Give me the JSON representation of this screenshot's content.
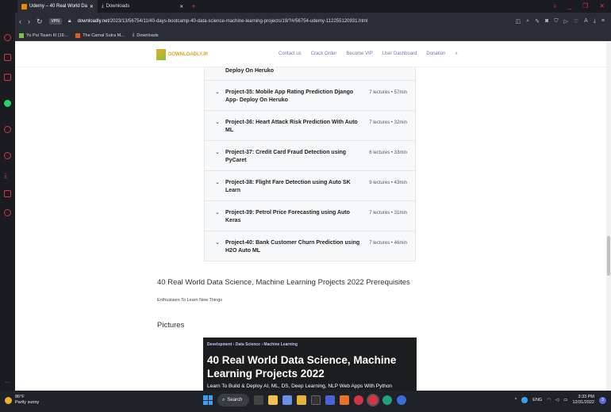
{
  "browser": {
    "tabs": [
      {
        "label": "Udemy – 40 Real World Da",
        "active": true
      },
      {
        "label": "Downloads",
        "active": false
      }
    ],
    "new_tab": "+",
    "vpn": "VPN",
    "url_domain": "downloadly.net",
    "url_path": "/2023/13/56754/11/40-days-bootcamp-40-data-science-machine-learning-projects/19/?#/56754-udemy-112255120931.html",
    "bookmarks": [
      "Yu Pui Tsuen III (19...",
      "The Carnal Sutra M...",
      "Downloads"
    ]
  },
  "site": {
    "logo_text": "DOWNLOADLY.IR",
    "menu": [
      "Contact us",
      "Crack Order",
      "Become VIP",
      "User Dashboard",
      "Donation"
    ],
    "partial_row_title": "Deploy On Heruko",
    "course_rows": [
      {
        "title": "Project-35: Mobile App Rating Prediction Django App- Deploy On Heruko",
        "meta": "7 lectures • 57min"
      },
      {
        "title": "Project-36: Heart Attack Risk Prediction With Auto ML",
        "meta": "7 lectures • 32min"
      },
      {
        "title": "Project-37: Credit Card Fraud Detection using PyCaret",
        "meta": "6 lectures • 33min"
      },
      {
        "title": "Project-38: Flight Fare Detection using Auto SK Learn",
        "meta": "9 lectures • 43min"
      },
      {
        "title": "Project-39: Petrol Price Forecasting using Auto Keras",
        "meta": "7 lectures • 31min"
      },
      {
        "title": "Project-40: Bank Customer Churn Prediction using H2O Auto ML",
        "meta": "7 lectures • 46min"
      }
    ],
    "prereq_heading": "40 Real World Data Science, Machine Learning Projects 2022 Prerequisites",
    "prereq_text": "Enthusiasm To Learn New Things",
    "pictures_heading": "Pictures",
    "picture": {
      "crumbs": "Development  ›  Data Science  ›  Machine Learning",
      "title": "40 Real World Data Science, Machine Learning Projects 2022",
      "subtitle": "Learn To Build & Deploy AI, ML, DS, Deep Learning, NLP Web Apps With Python"
    }
  },
  "taskbar": {
    "temp": "86°F",
    "weather": "Partly sunny",
    "search": "Search",
    "lang": "ENG",
    "time": "3:33 PM",
    "date": "12/31/2022",
    "notif_count": "3"
  }
}
